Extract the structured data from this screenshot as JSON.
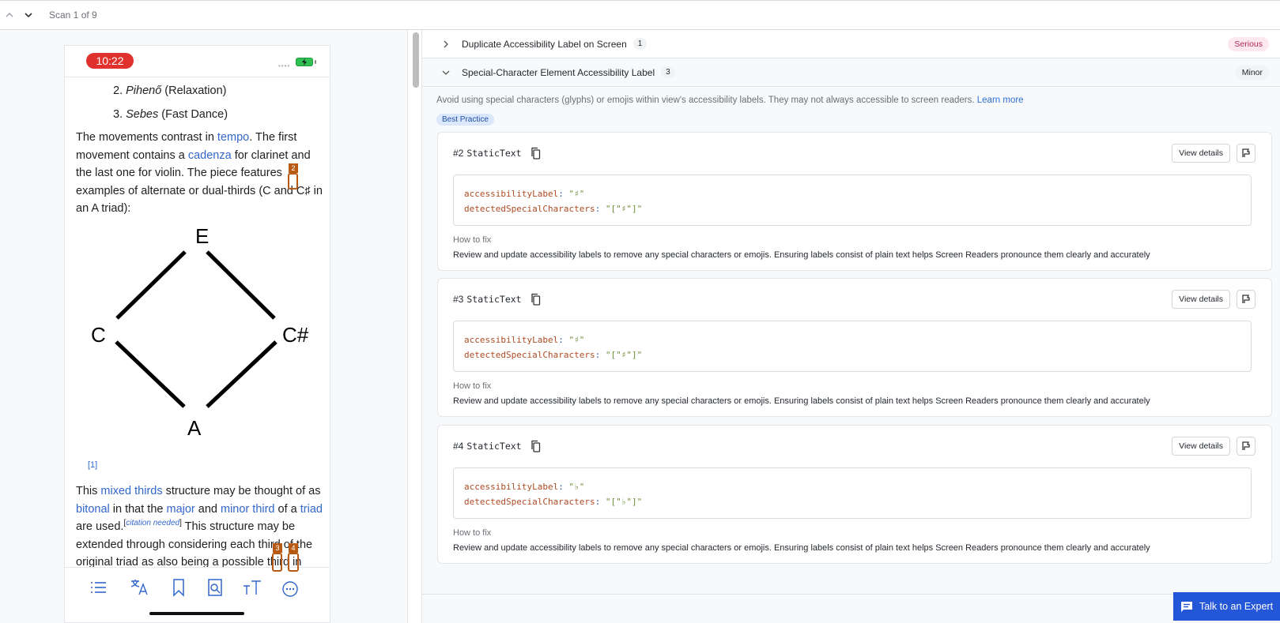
{
  "topbar": {
    "scan_label": "Scan 1 of 9",
    "prev_icon": "chevron-up-icon",
    "next_icon": "chevron-down-icon"
  },
  "phone": {
    "time": "10:22",
    "article": {
      "list_items": [
        {
          "num": "2. ",
          "italic": "Pihenő",
          "rest": " (Relaxation)"
        },
        {
          "num": "3. ",
          "italic": "Sebes",
          "rest": " (Fast Dance)"
        }
      ],
      "para1": {
        "t1": "The movements contrast in ",
        "l1": "tempo",
        "t2": ". The first movement contains a ",
        "l2": "cadenza",
        "t3": " for clarinet and the last one for violin. The piece features examples of alternate or dual-thirds (C and C",
        "sharp": "♯",
        "t4": " in an A triad):"
      },
      "diagram": {
        "top": "E",
        "left": "C",
        "right": "C#",
        "bottom": "A"
      },
      "citation": "[1]",
      "para2": {
        "t1": "This ",
        "l1": "mixed thirds",
        "t2": " structure may be thought of as ",
        "l2": "bitonal",
        "t3": " in that the ",
        "l3": "major",
        "t4": " and ",
        "l4": "minor third",
        "t5": " of a ",
        "l5": "triad",
        "t6": " are used.",
        "cite_open": "[",
        "cite": "citation needed",
        "cite_close": "]",
        "t7": " This structure may be extended through considering each third of the original triad as also being a possible third in"
      }
    },
    "markers": [
      {
        "label": "2"
      },
      {
        "label": "3"
      },
      {
        "label": "4"
      }
    ],
    "tabbar": [
      {
        "icon": "contents-list-icon"
      },
      {
        "icon": "translate-icon"
      },
      {
        "icon": "bookmark-icon"
      },
      {
        "icon": "find-in-page-icon"
      },
      {
        "icon": "text-size-icon"
      },
      {
        "icon": "more-icon"
      }
    ]
  },
  "issues": [
    {
      "title": "Duplicate Accessibility Label on Screen",
      "count": "1",
      "severity": "Serious",
      "expanded": false
    },
    {
      "title": "Special-Character Element Accessibility Label",
      "count": "3",
      "severity": "Minor",
      "expanded": true
    }
  ],
  "expanded": {
    "description": "Avoid using special characters (glyphs) or emojis within view's accessibility labels. They may not always accessible to screen readers. ",
    "learn_more": "Learn more",
    "badge": "Best Practice",
    "cards": [
      {
        "num": "#2",
        "type": "StaticText",
        "k1": "accessibilityLabel",
        "v1": "\"♯\"",
        "k2": "detectedSpecialCharacters",
        "v2": "\"[\"♯\"]\"",
        "view_label": "View details",
        "howto_title": "How to fix",
        "howto_text": "Review and update accessibility labels to remove any special characters or emojis. Ensuring labels consist of plain text helps Screen Readers pronounce them clearly and accurately"
      },
      {
        "num": "#3",
        "type": "StaticText",
        "k1": "accessibilityLabel",
        "v1": "\"♯\"",
        "k2": "detectedSpecialCharacters",
        "v2": "\"[\"♯\"]\"",
        "view_label": "View details",
        "howto_title": "How to fix",
        "howto_text": "Review and update accessibility labels to remove any special characters or emojis. Ensuring labels consist of plain text helps Screen Readers pronounce them clearly and accurately"
      },
      {
        "num": "#4",
        "type": "StaticText",
        "k1": "accessibilityLabel",
        "v1": "\"♭\"",
        "k2": "detectedSpecialCharacters",
        "v2": "\"[\"♭\"]\"",
        "view_label": "View details",
        "howto_title": "How to fix",
        "howto_text": "Review and update accessibility labels to remove any special characters or emojis. Ensuring labels consist of plain text helps Screen Readers pronounce them clearly and accurately"
      }
    ]
  },
  "expert_button": {
    "label": "Talk to an Expert",
    "icon": "chat-icon"
  },
  "colors": {
    "accent": "#2456d8",
    "link": "#3366cc",
    "marker": "#b85a14",
    "serious_bg": "#fde8f0",
    "serious_fg": "#b0285b",
    "time_pill": "#e0312d"
  }
}
